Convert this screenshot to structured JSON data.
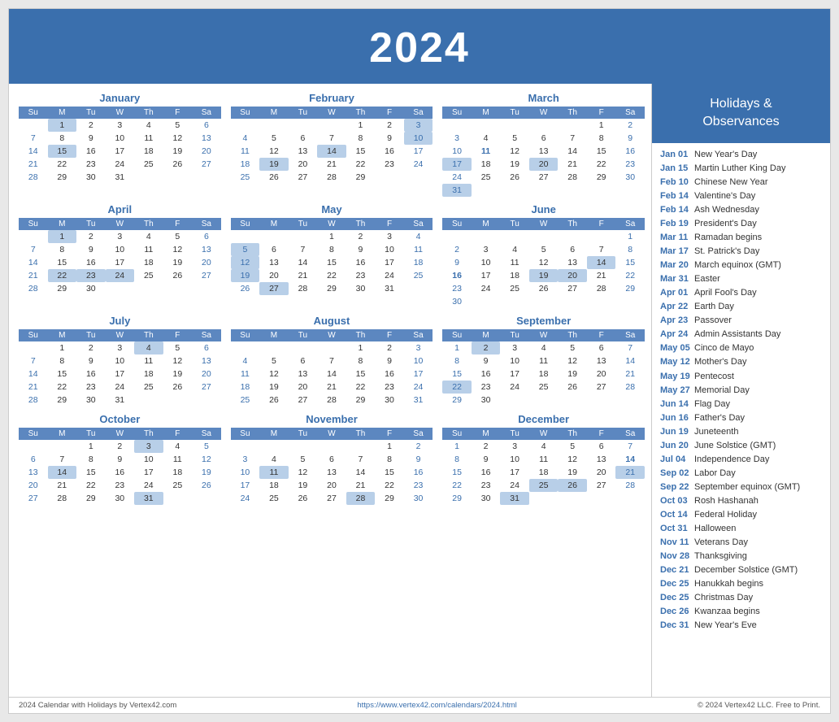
{
  "header": {
    "year": "2024"
  },
  "sidebar": {
    "title": "Holidays &\nObservances",
    "items": [
      {
        "date": "Jan 01",
        "name": "New Year's Day"
      },
      {
        "date": "Jan 15",
        "name": "Martin Luther King Day"
      },
      {
        "date": "Feb 10",
        "name": "Chinese New Year"
      },
      {
        "date": "Feb 14",
        "name": "Valentine's Day"
      },
      {
        "date": "Feb 14",
        "name": "Ash Wednesday"
      },
      {
        "date": "Feb 19",
        "name": "President's Day"
      },
      {
        "date": "Mar 11",
        "name": "Ramadan begins"
      },
      {
        "date": "Mar 17",
        "name": "St. Patrick's Day"
      },
      {
        "date": "Mar 20",
        "name": "March equinox (GMT)"
      },
      {
        "date": "Mar 31",
        "name": "Easter"
      },
      {
        "date": "Apr 01",
        "name": "April Fool's Day"
      },
      {
        "date": "Apr 22",
        "name": "Earth Day"
      },
      {
        "date": "Apr 23",
        "name": "Passover"
      },
      {
        "date": "Apr 24",
        "name": "Admin Assistants Day"
      },
      {
        "date": "May 05",
        "name": "Cinco de Mayo"
      },
      {
        "date": "May 12",
        "name": "Mother's Day"
      },
      {
        "date": "May 19",
        "name": "Pentecost"
      },
      {
        "date": "May 27",
        "name": "Memorial Day"
      },
      {
        "date": "Jun 14",
        "name": "Flag Day"
      },
      {
        "date": "Jun 16",
        "name": "Father's Day"
      },
      {
        "date": "Jun 19",
        "name": "Juneteenth"
      },
      {
        "date": "Jun 20",
        "name": "June Solstice (GMT)"
      },
      {
        "date": "Jul 04",
        "name": "Independence Day"
      },
      {
        "date": "Sep 02",
        "name": "Labor Day"
      },
      {
        "date": "Sep 22",
        "name": "September equinox (GMT)"
      },
      {
        "date": "Oct 03",
        "name": "Rosh Hashanah"
      },
      {
        "date": "Oct 14",
        "name": "Federal Holiday"
      },
      {
        "date": "Oct 31",
        "name": "Halloween"
      },
      {
        "date": "Nov 11",
        "name": "Veterans Day"
      },
      {
        "date": "Nov 28",
        "name": "Thanksgiving"
      },
      {
        "date": "Dec 21",
        "name": "December Solstice (GMT)"
      },
      {
        "date": "Dec 25",
        "name": "Hanukkah begins"
      },
      {
        "date": "Dec 25",
        "name": "Christmas Day"
      },
      {
        "date": "Dec 26",
        "name": "Kwanzaa begins"
      },
      {
        "date": "Dec 31",
        "name": "New Year's Eve"
      }
    ]
  },
  "footer": {
    "left": "2024 Calendar with Holidays by Vertex42.com",
    "center": "https://www.vertex42.com/calendars/2024.html",
    "right": "© 2024 Vertex42 LLC. Free to Print."
  },
  "months": [
    {
      "name": "January",
      "weeks": [
        [
          null,
          1,
          2,
          3,
          4,
          5,
          6
        ],
        [
          7,
          8,
          9,
          10,
          11,
          12,
          13
        ],
        [
          14,
          15,
          16,
          17,
          18,
          19,
          20
        ],
        [
          21,
          22,
          23,
          24,
          25,
          26,
          27
        ],
        [
          28,
          29,
          30,
          31,
          null,
          null,
          null
        ]
      ],
      "highlights": {
        "bg": [
          1,
          15
        ],
        "blue": []
      }
    },
    {
      "name": "February",
      "weeks": [
        [
          null,
          null,
          null,
          null,
          1,
          2,
          3
        ],
        [
          4,
          5,
          6,
          7,
          8,
          9,
          10
        ],
        [
          11,
          12,
          13,
          14,
          15,
          16,
          17
        ],
        [
          18,
          19,
          20,
          21,
          22,
          23,
          24
        ],
        [
          25,
          26,
          27,
          28,
          29,
          null,
          null
        ]
      ],
      "highlights": {
        "bg": [
          3,
          10,
          14,
          19
        ],
        "blue": []
      }
    },
    {
      "name": "March",
      "weeks": [
        [
          null,
          null,
          null,
          null,
          null,
          1,
          2
        ],
        [
          3,
          4,
          5,
          6,
          7,
          8,
          9
        ],
        [
          10,
          11,
          12,
          13,
          14,
          15,
          16
        ],
        [
          17,
          18,
          19,
          20,
          21,
          22,
          23
        ],
        [
          24,
          25,
          26,
          27,
          28,
          29,
          30
        ],
        [
          31,
          null,
          null,
          null,
          null,
          null,
          null
        ]
      ],
      "highlights": {
        "bg": [
          17,
          20,
          31
        ],
        "blue": [
          11
        ]
      }
    },
    {
      "name": "April",
      "weeks": [
        [
          null,
          1,
          2,
          3,
          4,
          5,
          6
        ],
        [
          7,
          8,
          9,
          10,
          11,
          12,
          13
        ],
        [
          14,
          15,
          16,
          17,
          18,
          19,
          20
        ],
        [
          21,
          22,
          23,
          24,
          25,
          26,
          27
        ],
        [
          28,
          29,
          30,
          null,
          null,
          null,
          null
        ]
      ],
      "highlights": {
        "bg": [
          1,
          22,
          23,
          24
        ],
        "blue": []
      }
    },
    {
      "name": "May",
      "weeks": [
        [
          null,
          null,
          null,
          1,
          2,
          3,
          4
        ],
        [
          5,
          6,
          7,
          8,
          9,
          10,
          11
        ],
        [
          12,
          13,
          14,
          15,
          16,
          17,
          18
        ],
        [
          19,
          20,
          21,
          22,
          23,
          24,
          25
        ],
        [
          26,
          27,
          28,
          29,
          30,
          31,
          null
        ]
      ],
      "highlights": {
        "bg": [
          5,
          12,
          19,
          27
        ],
        "blue": [
          27
        ]
      }
    },
    {
      "name": "June",
      "weeks": [
        [
          null,
          null,
          null,
          null,
          null,
          null,
          1
        ],
        [
          2,
          3,
          4,
          5,
          6,
          7,
          8
        ],
        [
          9,
          10,
          11,
          12,
          13,
          14,
          15
        ],
        [
          16,
          17,
          18,
          19,
          20,
          21,
          22
        ],
        [
          23,
          24,
          25,
          26,
          27,
          28,
          29
        ],
        [
          30,
          null,
          null,
          null,
          null,
          null,
          null
        ]
      ],
      "highlights": {
        "bg": [
          14,
          19,
          20
        ],
        "blue": [
          16
        ]
      }
    },
    {
      "name": "July",
      "weeks": [
        [
          null,
          1,
          2,
          3,
          4,
          5,
          6
        ],
        [
          7,
          8,
          9,
          10,
          11,
          12,
          13
        ],
        [
          14,
          15,
          16,
          17,
          18,
          19,
          20
        ],
        [
          21,
          22,
          23,
          24,
          25,
          26,
          27
        ],
        [
          28,
          29,
          30,
          31,
          null,
          null,
          null
        ]
      ],
      "highlights": {
        "bg": [
          4
        ],
        "blue": [
          4
        ]
      }
    },
    {
      "name": "August",
      "weeks": [
        [
          null,
          null,
          null,
          null,
          1,
          2,
          3
        ],
        [
          4,
          5,
          6,
          7,
          8,
          9,
          10
        ],
        [
          11,
          12,
          13,
          14,
          15,
          16,
          17
        ],
        [
          18,
          19,
          20,
          21,
          22,
          23,
          24
        ],
        [
          25,
          26,
          27,
          28,
          29,
          30,
          31
        ]
      ],
      "highlights": {
        "bg": [],
        "blue": []
      }
    },
    {
      "name": "September",
      "weeks": [
        [
          1,
          2,
          3,
          4,
          5,
          6,
          7
        ],
        [
          8,
          9,
          10,
          11,
          12,
          13,
          14
        ],
        [
          15,
          16,
          17,
          18,
          19,
          20,
          21
        ],
        [
          22,
          23,
          24,
          25,
          26,
          27,
          28
        ],
        [
          29,
          30,
          null,
          null,
          null,
          null,
          null
        ]
      ],
      "highlights": {
        "bg": [
          2,
          22
        ],
        "blue": [
          2
        ]
      }
    },
    {
      "name": "October",
      "weeks": [
        [
          null,
          null,
          1,
          2,
          3,
          4,
          5
        ],
        [
          6,
          7,
          8,
          9,
          10,
          11,
          12
        ],
        [
          13,
          14,
          15,
          16,
          17,
          18,
          19
        ],
        [
          20,
          21,
          22,
          23,
          24,
          25,
          26
        ],
        [
          27,
          28,
          29,
          30,
          31,
          null,
          null
        ]
      ],
      "highlights": {
        "bg": [
          3,
          14,
          31
        ],
        "blue": [
          3
        ]
      }
    },
    {
      "name": "November",
      "weeks": [
        [
          null,
          null,
          null,
          null,
          null,
          1,
          2
        ],
        [
          3,
          4,
          5,
          6,
          7,
          8,
          9
        ],
        [
          10,
          11,
          12,
          13,
          14,
          15,
          16
        ],
        [
          17,
          18,
          19,
          20,
          21,
          22,
          23
        ],
        [
          24,
          25,
          26,
          27,
          28,
          29,
          30
        ]
      ],
      "highlights": {
        "bg": [
          11,
          28
        ],
        "blue": [
          11,
          28
        ]
      }
    },
    {
      "name": "December",
      "weeks": [
        [
          1,
          2,
          3,
          4,
          5,
          6,
          7
        ],
        [
          8,
          9,
          10,
          11,
          12,
          13,
          14
        ],
        [
          15,
          16,
          17,
          18,
          19,
          20,
          21
        ],
        [
          22,
          23,
          24,
          25,
          26,
          27,
          28
        ],
        [
          29,
          30,
          31,
          null,
          null,
          null,
          null
        ]
      ],
      "highlights": {
        "bg": [
          21,
          25,
          26,
          31
        ],
        "blue": [
          14,
          21,
          25
        ]
      }
    }
  ],
  "dayHeaders": [
    "Su",
    "M",
    "Tu",
    "W",
    "Th",
    "F",
    "Sa"
  ]
}
